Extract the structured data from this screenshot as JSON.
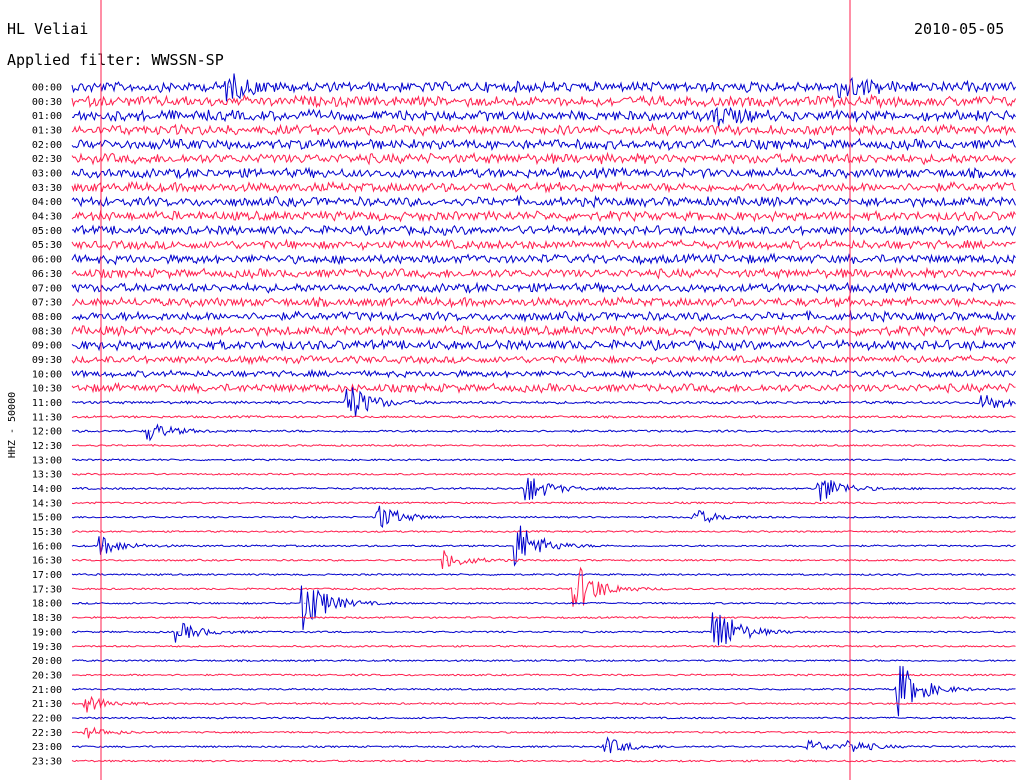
{
  "header": {
    "station": "HL Veliai",
    "date": "2010-05-05",
    "filter_label": "Applied filter: WWSSN-SP"
  },
  "chart_data": {
    "type": "line",
    "title": "HL Veliai",
    "ylabel": "HHZ - 50000",
    "colors": {
      "a": "#0000cc",
      "b": "#ff1f4e"
    },
    "rows": [
      "00:00",
      "00:30",
      "01:00",
      "01:30",
      "02:00",
      "02:30",
      "03:00",
      "03:30",
      "04:00",
      "04:30",
      "05:00",
      "05:30",
      "06:00",
      "06:30",
      "07:00",
      "07:30",
      "08:00",
      "08:30",
      "09:00",
      "09:30",
      "10:00",
      "10:30",
      "11:00",
      "11:30",
      "12:00",
      "12:30",
      "13:00",
      "13:30",
      "14:00",
      "14:30",
      "15:00",
      "15:30",
      "16:00",
      "16:30",
      "17:00",
      "17:30",
      "18:00",
      "18:30",
      "19:00",
      "19:30",
      "20:00",
      "20:30",
      "21:00",
      "21:30",
      "22:00",
      "22:30",
      "23:00",
      "23:30"
    ],
    "row_minutes": 30,
    "noise_level": [
      0.9,
      0.9,
      0.9,
      0.85,
      0.85,
      0.85,
      0.8,
      0.8,
      0.8,
      0.8,
      0.75,
      0.75,
      0.75,
      0.75,
      0.75,
      0.75,
      0.75,
      0.8,
      0.8,
      0.6,
      0.5,
      0.7,
      0.15,
      0.1,
      0.1,
      0.05,
      0.05,
      0.05,
      0.08,
      0.05,
      0.05,
      0.05,
      0.05,
      0.05,
      0.05,
      0.05,
      0.05,
      0.05,
      0.05,
      0.05,
      0.05,
      0.05,
      0.05,
      0.05,
      0.05,
      0.05,
      0.05,
      0.05
    ],
    "events": [
      {
        "row": "00:00",
        "minute": 5.0,
        "amplitude": 1.2
      },
      {
        "row": "00:00",
        "minute": 24.5,
        "amplitude": 1.3
      },
      {
        "row": "01:00",
        "minute": 20.5,
        "amplitude": 0.9
      },
      {
        "row": "11:00",
        "minute": 8.8,
        "amplitude": 2.2
      },
      {
        "row": "11:00",
        "minute": 29.0,
        "amplitude": 1.0
      },
      {
        "row": "12:00",
        "minute": 2.5,
        "amplitude": 1.0
      },
      {
        "row": "14:00",
        "minute": 14.5,
        "amplitude": 1.6
      },
      {
        "row": "14:00",
        "minute": 23.8,
        "amplitude": 1.6
      },
      {
        "row": "15:00",
        "minute": 9.8,
        "amplitude": 1.4
      },
      {
        "row": "15:00",
        "minute": 19.8,
        "amplitude": 0.9
      },
      {
        "row": "16:00",
        "minute": 1.0,
        "amplitude": 1.0
      },
      {
        "row": "16:00",
        "minute": 14.2,
        "amplitude": 2.6
      },
      {
        "row": "16:30",
        "minute": 11.9,
        "amplitude": 1.0
      },
      {
        "row": "17:30",
        "minute": 16.0,
        "amplitude": 3.0
      },
      {
        "row": "18:00",
        "minute": 7.4,
        "amplitude": 3.2
      },
      {
        "row": "19:00",
        "minute": 3.4,
        "amplitude": 1.1
      },
      {
        "row": "19:00",
        "minute": 20.5,
        "amplitude": 3.0
      },
      {
        "row": "21:00",
        "minute": 26.3,
        "amplitude": 3.0
      },
      {
        "row": "21:30",
        "minute": 0.5,
        "amplitude": 0.9
      },
      {
        "row": "22:30",
        "minute": 0.5,
        "amplitude": 0.6
      },
      {
        "row": "23:00",
        "minute": 17.0,
        "amplitude": 1.0
      },
      {
        "row": "23:00",
        "minute": 23.5,
        "amplitude": 0.7
      },
      {
        "row": "23:00",
        "minute": 24.7,
        "amplitude": 0.7
      }
    ]
  }
}
